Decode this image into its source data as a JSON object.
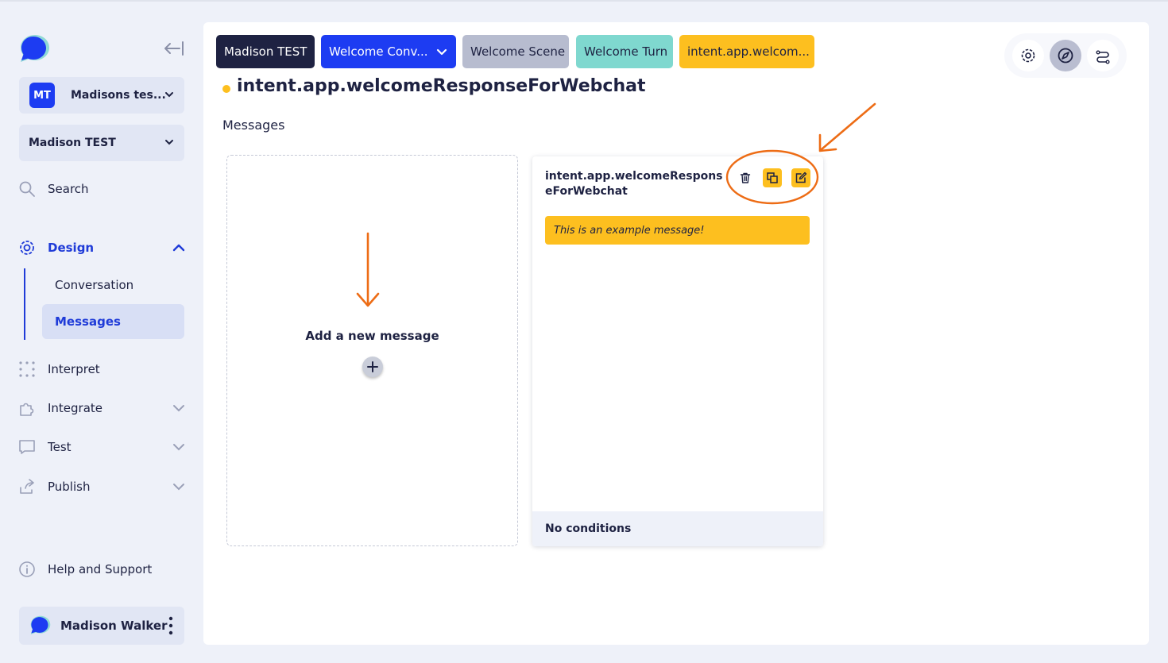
{
  "sidebar": {
    "workspace": {
      "badge": "MT",
      "name": "Madisons tes..."
    },
    "app_select": "Madison TEST",
    "nav": {
      "search": "Search",
      "design": "Design",
      "design_sub": [
        "Conversation",
        "Messages"
      ],
      "interpret": "Interpret",
      "integrate": "Integrate",
      "test": "Test",
      "publish": "Publish",
      "help": "Help and Support"
    },
    "user": "Madison Walker"
  },
  "breadcrumbs": [
    {
      "label": "Madison TEST"
    },
    {
      "label": "Welcome Conv..."
    },
    {
      "label": "Welcome Scene"
    },
    {
      "label": "Welcome Turn"
    },
    {
      "label": "intent.app.welcom..."
    }
  ],
  "page": {
    "title": "intent.app.welcomeResponseForWebchat",
    "section": "Messages"
  },
  "add_card": {
    "label": "Add a new message"
  },
  "message_card": {
    "title": "intent.app.welcomeResponseForWebchat",
    "message": "This is an example message!",
    "footer": "No conditions"
  },
  "colors": {
    "navy": "#1e2242",
    "blue": "#1d3cf2",
    "yellow": "#fdbf1f",
    "teal": "#7fd8cf",
    "grey": "#b7bccf",
    "annotation": "#ed6c15"
  },
  "icons": {
    "top_actions": [
      "settings-icon",
      "compass-icon",
      "flow-icon"
    ],
    "card_actions": [
      "trash-icon",
      "copy-icon",
      "edit-icon"
    ]
  }
}
